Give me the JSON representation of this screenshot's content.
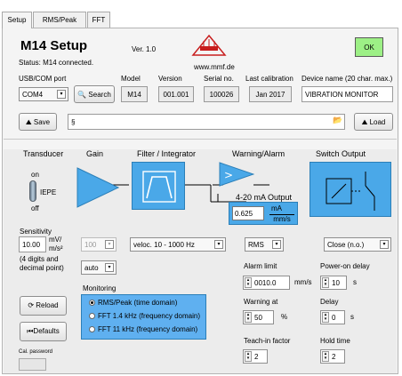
{
  "tabs": [
    {
      "label": "Setup",
      "active": true
    },
    {
      "label": "RMS/Peak",
      "active": false
    },
    {
      "label": "FFT",
      "active": false
    }
  ],
  "header": {
    "title": "M14 Setup",
    "version": "Ver. 1.0",
    "status": "Status:  M14 connected.",
    "website": "www.mmf.de",
    "logo_text": "MMF",
    "ok_label": "OK"
  },
  "device_info": {
    "usb_label": "USB/COM port",
    "com_port": "COM4",
    "search_label": "Search",
    "model_label": "Model",
    "model": "M14",
    "version_label": "Version",
    "version": "001.001",
    "serial_label": "Serial no.",
    "serial": "100026",
    "calibration_label": "Last calibration",
    "calibration": "Jan 2017",
    "device_name_label": "Device name (20 char. max.)",
    "device_name": "VIBRATION MONITOR"
  },
  "file_bar": {
    "save_label": "Save",
    "load_label": "Load",
    "path_value": "",
    "path_glyph": "§"
  },
  "diagram": {
    "transducer_label": "Transducer",
    "gain_label": "Gain",
    "filter_label": "Filter / Integrator",
    "warning_label": "Warning/Alarm",
    "switch_label": "Switch Output",
    "on_label": "on",
    "iepe_label": "IEPE",
    "off_label": "off",
    "output_label": "4-20 mA Output",
    "output_value": "0.625",
    "output_unit_top": "mA",
    "output_unit_bottom": "mm/s"
  },
  "sensitivity": {
    "label": "Sensitivity",
    "value": "10.00",
    "unit_top": "mV/",
    "unit_bottom": "m/s²",
    "hint_1": "(4 digits and",
    "hint_2": "decimal point)"
  },
  "gain": {
    "value": "100",
    "mode": "auto"
  },
  "filter": {
    "value": "veloc. 10 - 1000 Hz"
  },
  "measure": {
    "mode": "RMS"
  },
  "switch_mode": {
    "value": "Close (n.o.)"
  },
  "monitoring": {
    "label": "Monitoring",
    "options": [
      {
        "label": "RMS/Peak (time domain)",
        "selected": true
      },
      {
        "label": "FFT 1.4 kHz (frequency domain)",
        "selected": false
      },
      {
        "label": "FFT 11 kHz (frequency domain)",
        "selected": false
      }
    ]
  },
  "alarm": {
    "limit_label": "Alarm limit",
    "limit_value": "0010.0",
    "limit_unit": "mm/s",
    "warning_label": "Warning at",
    "warning_value": "50",
    "warning_unit": "%",
    "teach_label": "Teach-in factor",
    "teach_value": "2"
  },
  "timing": {
    "power_on_label": "Power-on delay",
    "power_on_value": "10",
    "power_on_unit": "s",
    "delay_label": "Delay",
    "delay_value": "0",
    "delay_unit": "s",
    "hold_label": "Hold time",
    "hold_value": "2"
  },
  "buttons": {
    "reload_label": "Reload",
    "defaults_label": "Defaults"
  },
  "calibration": {
    "password_label": "Cal. password",
    "password_value": ""
  }
}
